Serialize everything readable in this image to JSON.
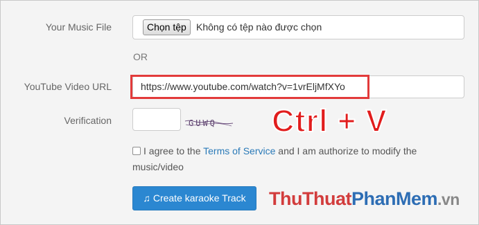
{
  "form": {
    "music_file_label": "Your Music File",
    "choose_file_button": "Chọn tệp",
    "no_file_text": "Không có tệp nào được chọn",
    "or_text": "OR",
    "youtube_label": "YouTube Video URL",
    "youtube_url_value": "https://www.youtube.com/watch?v=1vrEljMfXYo",
    "verification_label": "Verification",
    "verification_value": "",
    "captcha_text": "GUWQ",
    "agree_prefix": "I agree to the ",
    "terms_link": "Terms of Service",
    "agree_suffix": " and I am authorize to modify the music/video",
    "agree_checked": false,
    "create_button": "Create karaoke Track",
    "create_button_icon": "music-note-icon"
  },
  "annotation": {
    "shortcut_text": "Ctrl + V",
    "highlight_color": "#e23a3a"
  },
  "watermark": {
    "part1": "Thu",
    "part2": "Thuat",
    "part3": "Phan",
    "part4": "Mem",
    "part5": ".vn"
  },
  "colors": {
    "primary_button": "#2b87d1",
    "link": "#2a7ab8",
    "shortcut_red": "#e11d1d"
  }
}
